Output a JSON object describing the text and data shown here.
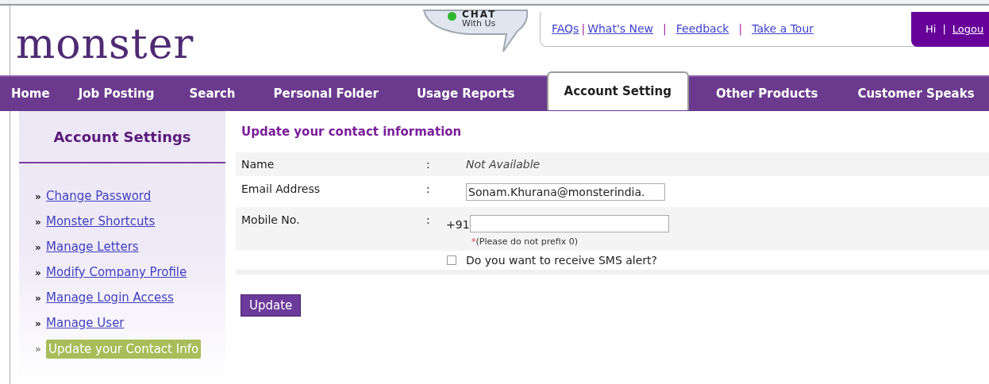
{
  "logo": "monster",
  "chat": {
    "title": "CHAT",
    "subtitle": "With Us"
  },
  "top_links": [
    "FAQs",
    "What's New",
    "Feedback",
    "Take a Tour"
  ],
  "link_separator": "|",
  "user_bar": {
    "greeting": "Hi",
    "separator": "|",
    "logout": "Logou"
  },
  "nav": [
    {
      "label": "Home",
      "selected": false
    },
    {
      "label": "Job Posting",
      "selected": false
    },
    {
      "label": "Search",
      "selected": false
    },
    {
      "label": "Personal Folder",
      "selected": false
    },
    {
      "label": "Usage Reports",
      "selected": false
    },
    {
      "label": "Account Setting",
      "selected": true
    },
    {
      "label": "Other Products",
      "selected": false
    },
    {
      "label": "Customer Speaks",
      "selected": false
    }
  ],
  "sidebar": {
    "title": "Account Settings",
    "bullet": "»",
    "items": [
      {
        "label": "Change Password",
        "selected": false
      },
      {
        "label": "Monster Shortcuts",
        "selected": false
      },
      {
        "label": "Manage Letters",
        "selected": false
      },
      {
        "label": "Modify Company Profile",
        "selected": false
      },
      {
        "label": "Manage Login Access",
        "selected": false
      },
      {
        "label": "Manage User",
        "selected": false
      },
      {
        "label": "Update your Contact Info",
        "selected": true
      }
    ]
  },
  "form": {
    "title": "Update your contact information",
    "separator": ":",
    "rows": [
      {
        "kind": "text",
        "label": "Name",
        "value": "Not Available"
      },
      {
        "kind": "input",
        "label": "Email Address",
        "value": "Sonam.Khurana@monsterindia."
      },
      {
        "kind": "phone",
        "label": "Mobile No.",
        "prefix": "+91",
        "hint_mark": "*",
        "hint": "(Please do not prefix 0)"
      }
    ],
    "sms": {
      "label": "Do you want to receive SMS alert?",
      "checked": false
    },
    "button": "Update"
  }
}
